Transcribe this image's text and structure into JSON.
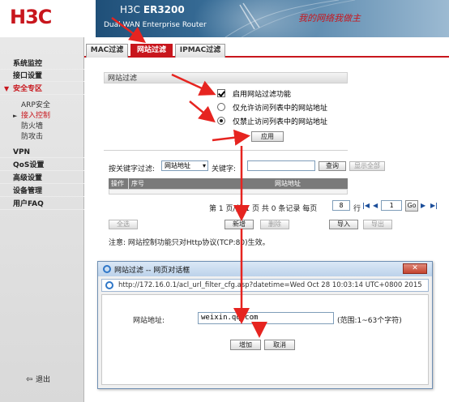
{
  "header": {
    "logo": "H3C",
    "model_brand": "H3C",
    "model_name": "ER3200",
    "subtitle": "Dual WAN Enterprise Router",
    "slogan": "我的网络我做主"
  },
  "sidebar": {
    "items": [
      {
        "label": "系统监控"
      },
      {
        "label": "接口设置"
      },
      {
        "label": "安全专区"
      },
      {
        "label": "VPN"
      },
      {
        "label": "QoS设置"
      },
      {
        "label": "高级设置"
      },
      {
        "label": "设备管理"
      },
      {
        "label": "用户FAQ"
      }
    ],
    "subitems": [
      {
        "label": "ARP安全"
      },
      {
        "label": "接入控制"
      },
      {
        "label": "防火墙"
      },
      {
        "label": "防攻击"
      }
    ],
    "logout": "退出"
  },
  "tabs": [
    {
      "label": "MAC过滤"
    },
    {
      "label": "网站过滤"
    },
    {
      "label": "IPMAC过滤"
    }
  ],
  "filter": {
    "section_title": "网站过滤",
    "enable_label": "启用网站过滤功能",
    "allow_label": "仅允许访问列表中的网站地址",
    "deny_label": "仅禁止访问列表中的网站地址",
    "apply_button": "应用"
  },
  "search": {
    "keyword_filter_label": "按关键字过滤:",
    "select_value": "网站地址",
    "keyword_label": "关键字:",
    "keyword_value": "",
    "search_button": "查询",
    "show_all_button": "显示全部"
  },
  "table": {
    "columns": [
      "操作",
      "序号",
      "网站地址"
    ]
  },
  "pagination": {
    "page_prefix": "第",
    "current_page": "1",
    "page_sep": "页/共",
    "total_pages": "1",
    "page_suffix": "页 共",
    "records": "0",
    "records_suffix": "条记录 每页",
    "per_page": "8",
    "rows_label": "行",
    "goto_value": "1",
    "go_button": "Go"
  },
  "actions": {
    "select_all": "全选",
    "add": "新增",
    "delete": "删除",
    "import": "导入",
    "export": "导出"
  },
  "note": "注意: 网站控制功能只对Http协议(TCP:80)生效。",
  "dialog": {
    "title": "网站过滤 -- 网页对话框",
    "url": "http://172.16.0.1/acl_url_filter_cfg.asp?datetime=Wed Oct 28 10:03:14 UTC+0800 2015",
    "field_label": "网站地址:",
    "field_value": "weixin.qq.com",
    "range_hint": "(范围:1~63个字符)",
    "add_button": "增加",
    "cancel_button": "取消"
  },
  "colors": {
    "accent": "#c8161d",
    "annotation": "#e62420"
  }
}
